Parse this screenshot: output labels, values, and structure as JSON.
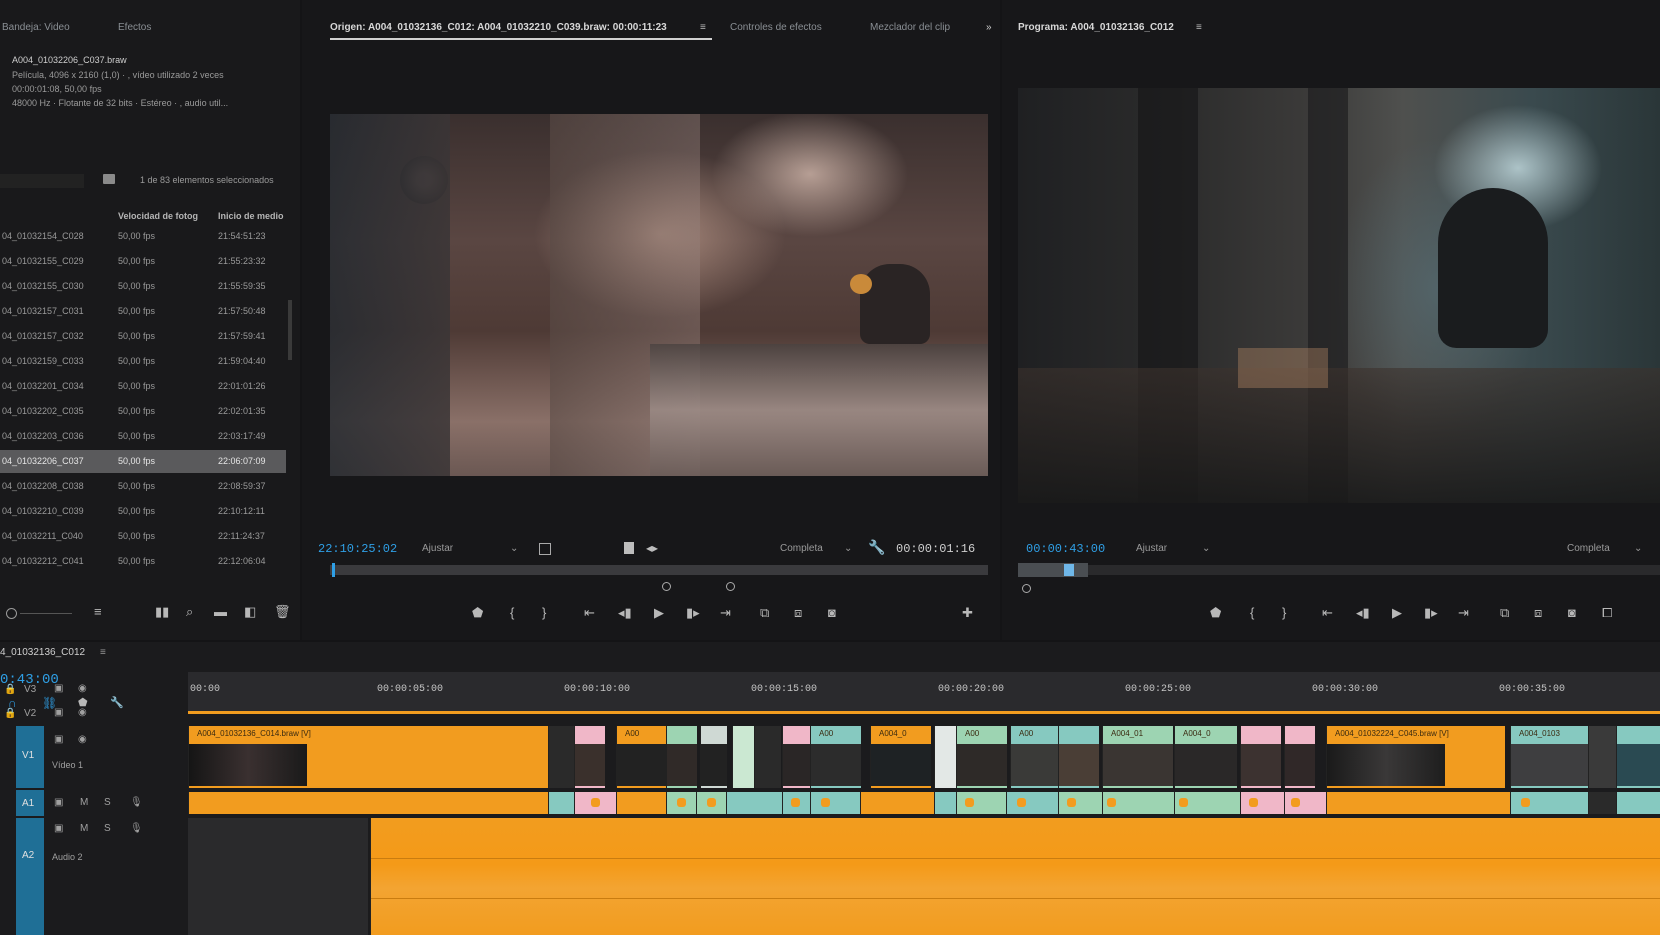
{
  "project": {
    "tabs": [
      "Bandeja: Video",
      "Efectos"
    ],
    "clip_name": "A004_01032206_C037.braw",
    "clip_info_1": "Película, 4096 x 2160 (1,0)  ·  , vídeo utilizado 2 veces",
    "clip_info_2": "00:00:01:08, 50,00 fps",
    "clip_info_3": "48000 Hz · Flotante de 32 bits · Estéreo  ·  , audio util...",
    "selection_status": "1 de 83 elementos seleccionados",
    "col_name": "",
    "col_fps": "Velocidad de fotog",
    "col_start": "Inicio de medio",
    "rows": [
      {
        "name": "04_01032154_C028",
        "fps": "50,00 fps",
        "start": "21:54:51:23"
      },
      {
        "name": "04_01032155_C029",
        "fps": "50,00 fps",
        "start": "21:55:23:32"
      },
      {
        "name": "04_01032155_C030",
        "fps": "50,00 fps",
        "start": "21:55:59:35"
      },
      {
        "name": "04_01032157_C031",
        "fps": "50,00 fps",
        "start": "21:57:50:48"
      },
      {
        "name": "04_01032157_C032",
        "fps": "50,00 fps",
        "start": "21:57:59:41"
      },
      {
        "name": "04_01032159_C033",
        "fps": "50,00 fps",
        "start": "21:59:04:40"
      },
      {
        "name": "04_01032201_C034",
        "fps": "50,00 fps",
        "start": "22:01:01:26"
      },
      {
        "name": "04_01032202_C035",
        "fps": "50,00 fps",
        "start": "22:02:01:35"
      },
      {
        "name": "04_01032203_C036",
        "fps": "50,00 fps",
        "start": "22:03:17:49"
      },
      {
        "name": "04_01032206_C037",
        "fps": "50,00 fps",
        "start": "22:06:07:09",
        "selected": true
      },
      {
        "name": "04_01032208_C038",
        "fps": "50,00 fps",
        "start": "22:08:59:37"
      },
      {
        "name": "04_01032210_C039",
        "fps": "50,00 fps",
        "start": "22:10:12:11"
      },
      {
        "name": "04_01032211_C040",
        "fps": "50,00 fps",
        "start": "22:11:24:37"
      },
      {
        "name": "04_01032212_C041",
        "fps": "50,00 fps",
        "start": "22:12:06:04"
      }
    ]
  },
  "source": {
    "tab_origin": "Origen: A004_01032136_C012: A004_01032210_C039.braw: 00:00:11:23",
    "tab_effects": "Controles de efectos",
    "tab_mixer": "Mezclador del clip",
    "overflow": "»",
    "timecode": "22:10:25:02",
    "fit": "Ajustar",
    "quality": "Completa",
    "duration": "00:00:01:16"
  },
  "program": {
    "tab": "Programa: A004_01032136_C012",
    "timecode": "00:00:43:00",
    "fit": "Ajustar",
    "quality": "Completa"
  },
  "timeline": {
    "sequence": "4_01032136_C012",
    "timecode": "0:43:00",
    "ruler": [
      "00:00",
      "00:00:05:00",
      "00:00:10:00",
      "00:00:15:00",
      "00:00:20:00",
      "00:00:25:00",
      "00:00:30:00",
      "00:00:35:00"
    ],
    "tracks": {
      "v3": "V3",
      "v2": "V2",
      "v1": "V1",
      "v1_name": "Vídeo 1",
      "a1": "A1",
      "a2": "A2",
      "a2_name": "Audio 2"
    },
    "clip_labels": {
      "c1": "A004_01032136_C014.braw [V]",
      "c2": "A00",
      "c3": "A00",
      "c4": "A004_0",
      "c5": "A00",
      "c6": "A00",
      "c7": "A004_01",
      "c8": "A004_0",
      "c9": "A004_01032224_C045.braw [V]",
      "c10": "A004_0103"
    }
  },
  "colors": {
    "accent_timecode": "#2f9fe5",
    "clip_orange": "#f29c1f",
    "clip_teal": "#86c9c0",
    "clip_pink": "#f0b7c8",
    "clip_green": "#9dd4b2"
  }
}
